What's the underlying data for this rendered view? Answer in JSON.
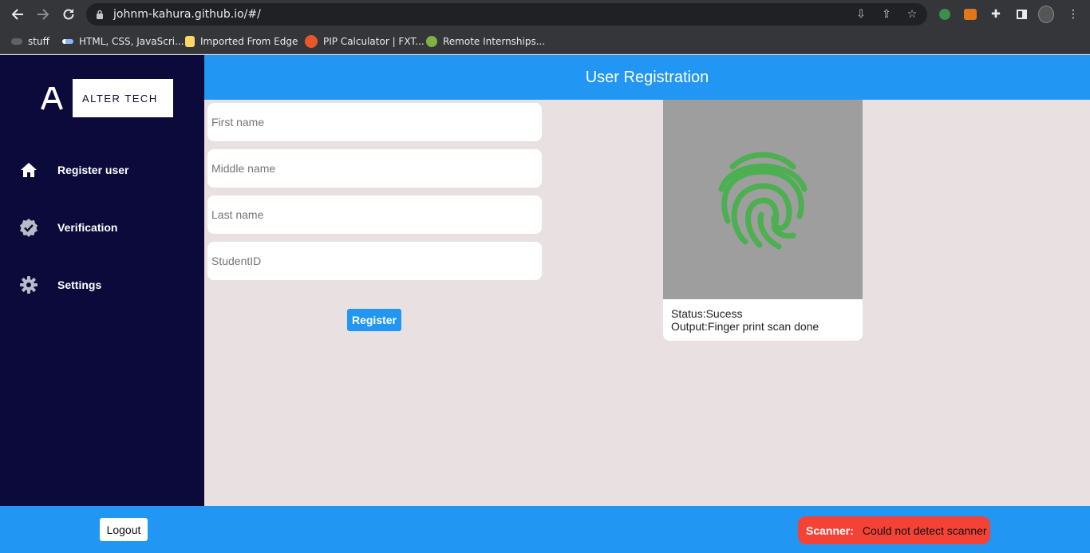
{
  "browser": {
    "url": "johnm-kahura.github.io/#/",
    "bookmarks": [
      {
        "label": "stuff",
        "icon": "cloud-icon"
      },
      {
        "label": "HTML, CSS, JavaScri...",
        "icon": "code-icon"
      },
      {
        "label": "Imported From Edge",
        "icon": "folder-icon"
      },
      {
        "label": "PIP Calculator | FXT...",
        "icon": "pip-icon"
      },
      {
        "label": "Remote Internships...",
        "icon": "intern-icon"
      }
    ]
  },
  "sidebar": {
    "logo_text": "ALTER TECH",
    "logo_mark": "A",
    "items": [
      {
        "label": "Register user",
        "icon": "home-icon"
      },
      {
        "label": "Verification",
        "icon": "verified-badge-icon"
      },
      {
        "label": "Settings",
        "icon": "gear-icon"
      }
    ]
  },
  "header": {
    "title": "User Registration"
  },
  "form": {
    "first_name_placeholder": "First name",
    "middle_name_placeholder": "Middle name",
    "last_name_placeholder": "Last name",
    "student_id_placeholder": "StudentID",
    "register_label": "Register"
  },
  "scanner_panel": {
    "status": "Status:Sucess",
    "output": "Output:Finger print scan done",
    "fingerprint_color": "#4caf50"
  },
  "footer": {
    "logout_label": "Logout",
    "scanner_label": "Scanner:",
    "scanner_message": "Could not detect scanner"
  },
  "colors": {
    "sidebar_bg": "#0b0a3b",
    "accent": "#2196f3",
    "content_bg": "#e9e1e1",
    "error": "#f44336"
  }
}
